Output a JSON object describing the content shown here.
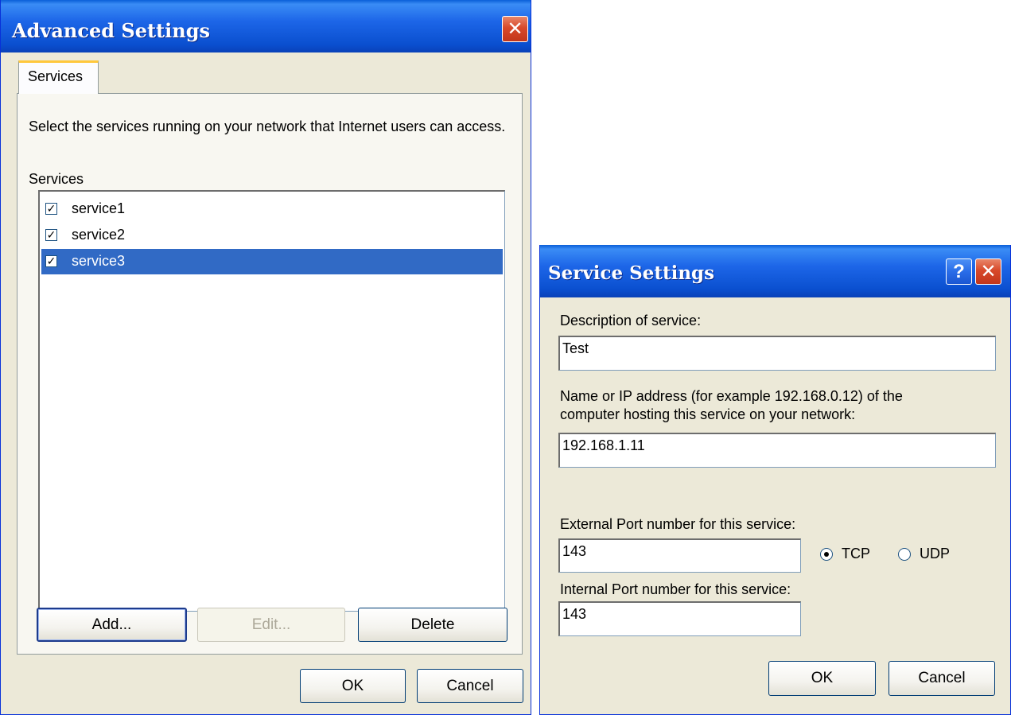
{
  "advanced": {
    "title": "Advanced Settings",
    "tab": "Services",
    "description": "Select the services running on your network that Internet users can access.",
    "list_label": "Services",
    "services": [
      {
        "label": "service1",
        "checked": true,
        "selected": false
      },
      {
        "label": "service2",
        "checked": true,
        "selected": false
      },
      {
        "label": "service3",
        "checked": true,
        "selected": true
      }
    ],
    "add_label": "Add...",
    "edit_label": "Edit...",
    "delete_label": "Delete",
    "ok_label": "OK",
    "cancel_label": "Cancel",
    "close_icon": "close-icon"
  },
  "service": {
    "title": "Service Settings",
    "help_icon": "help-icon",
    "close_icon": "close-icon",
    "desc_label": "Description of service:",
    "desc_value": "Test",
    "host_label_line1": "Name or IP address (for example 192.168.0.12) of the",
    "host_label_line2": "computer hosting this service on your network:",
    "host_value": "192.168.1.11",
    "ext_label": "External Port number for this service:",
    "ext_value": "143",
    "int_label": "Internal Port number for this service:",
    "int_value": "143",
    "protocol_tcp": "TCP",
    "protocol_udp": "UDP",
    "protocol_selected": "TCP",
    "ok_label": "OK",
    "cancel_label": "Cancel"
  },
  "colors": {
    "title_blue": "#0a4fcf",
    "dialog_bg": "#ece9d8",
    "selection": "#316ac5",
    "close_red": "#d8492a"
  }
}
